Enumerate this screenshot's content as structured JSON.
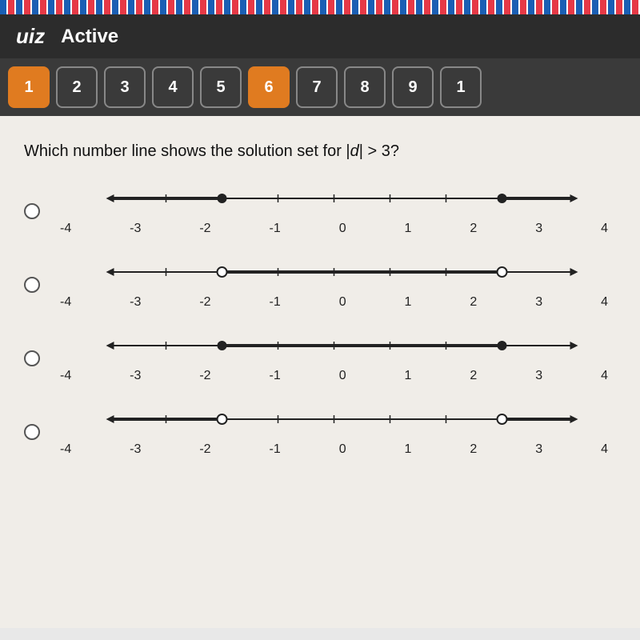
{
  "topbar": {
    "label": "uiz",
    "status": "Active"
  },
  "tabs": {
    "items": [
      {
        "label": "1",
        "active": false,
        "first": true
      },
      {
        "label": "2",
        "active": false
      },
      {
        "label": "3",
        "active": false
      },
      {
        "label": "4",
        "active": false
      },
      {
        "label": "5",
        "active": false
      },
      {
        "label": "6",
        "active": true
      },
      {
        "label": "7",
        "active": false
      },
      {
        "label": "8",
        "active": false
      },
      {
        "label": "9",
        "active": false
      },
      {
        "label": "1",
        "active": false
      }
    ]
  },
  "question": {
    "text": "Which number line shows the solution set for |d| > 3?",
    "display": "Which number line shows the solution set for "
  },
  "options": [
    {
      "id": "A",
      "description": "Number line with filled dots at -3 and 3, arrows pointing outward (shaded outside)",
      "type": "filled-outward"
    },
    {
      "id": "B",
      "description": "Number line with open dots at -3 and 3, shaded between (middle segment bold)",
      "type": "open-inward"
    },
    {
      "id": "C",
      "description": "Number line with filled dots at -3 and 3, shaded between (middle segment bold)",
      "type": "filled-inward"
    },
    {
      "id": "D",
      "description": "Number line with open dots at -3 and 3, arrows pointing outward",
      "type": "open-outward"
    }
  ],
  "numberline": {
    "labels": [
      "-4",
      "-3",
      "-2",
      "-1",
      "0",
      "1",
      "2",
      "3",
      "4"
    ]
  }
}
